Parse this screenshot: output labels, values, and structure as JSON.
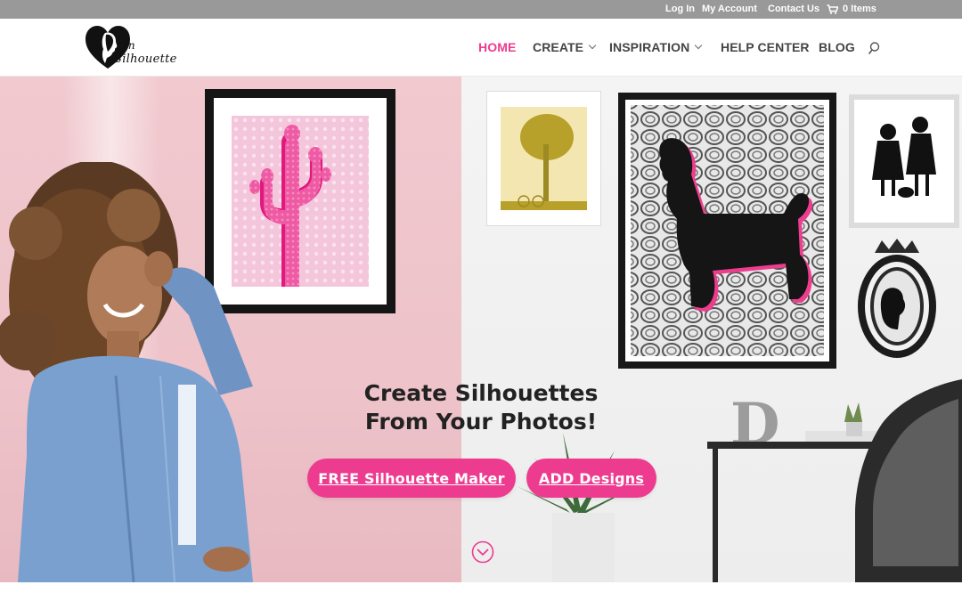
{
  "topbar": {
    "login": "Log In",
    "account": "My Account",
    "contact": "Contact Us",
    "cart_icon": "cart-icon",
    "cart_count": "0 Items"
  },
  "brand": {
    "logo_text_top": "in",
    "logo_text_bottom": "Silhouette",
    "accent_color": "#ed3c8f"
  },
  "nav": {
    "items": [
      {
        "label": "HOME",
        "active": true
      },
      {
        "label": "CREATE",
        "dropdown": true
      },
      {
        "label": "INSPIRATION",
        "dropdown": true
      },
      {
        "label": "HELP CENTER"
      },
      {
        "label": "BLOG"
      }
    ],
    "search_icon": "search-icon"
  },
  "hero": {
    "headline_line1": "Create Silhouettes",
    "headline_line2": "From Your Photos!",
    "cta_primary": "FREE Silhouette Maker",
    "cta_secondary": "ADD Designs",
    "scroll_icon": "chevron-down-circle-icon",
    "decor_letter": "D"
  }
}
